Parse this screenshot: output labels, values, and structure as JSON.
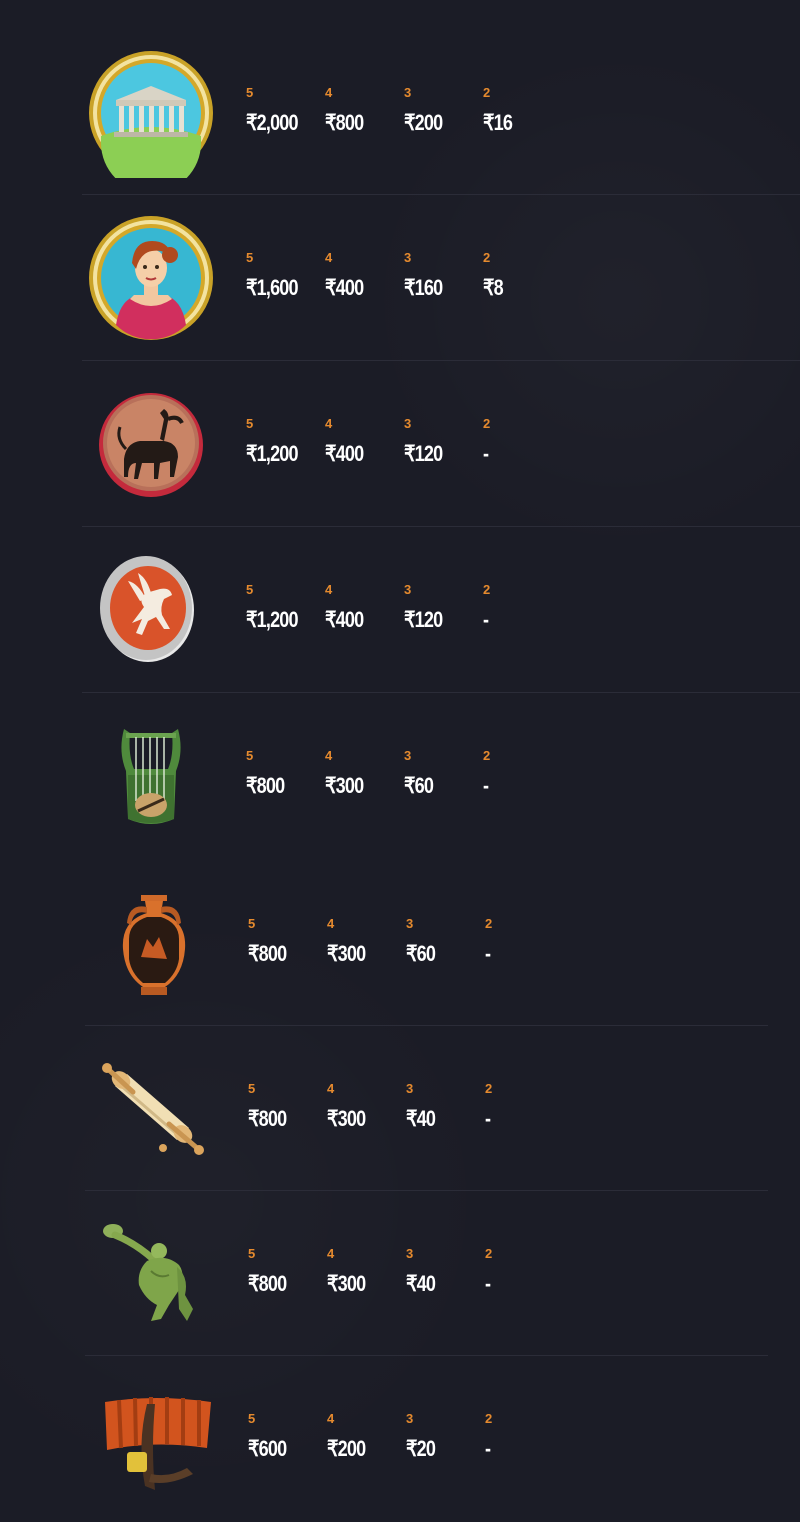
{
  "paytable": {
    "rows": [
      {
        "symbol_icon": "temple-icon",
        "pays": [
          {
            "count": "5",
            "amount": "₹2,000"
          },
          {
            "count": "4",
            "amount": "₹800"
          },
          {
            "count": "3",
            "amount": "₹200"
          },
          {
            "count": "2",
            "amount": "₹16"
          }
        ]
      },
      {
        "symbol_icon": "woman-portrait-icon",
        "pays": [
          {
            "count": "5",
            "amount": "₹1,600"
          },
          {
            "count": "4",
            "amount": "₹400"
          },
          {
            "count": "3",
            "amount": "₹160"
          },
          {
            "count": "2",
            "amount": "₹8"
          }
        ]
      },
      {
        "symbol_icon": "centaur-plate-icon",
        "pays": [
          {
            "count": "5",
            "amount": "₹1,200"
          },
          {
            "count": "4",
            "amount": "₹400"
          },
          {
            "count": "3",
            "amount": "₹120"
          },
          {
            "count": "2",
            "amount": "-"
          }
        ]
      },
      {
        "symbol_icon": "pegasus-shield-icon",
        "pays": [
          {
            "count": "5",
            "amount": "₹1,200"
          },
          {
            "count": "4",
            "amount": "₹400"
          },
          {
            "count": "3",
            "amount": "₹120"
          },
          {
            "count": "2",
            "amount": "-"
          }
        ]
      },
      {
        "symbol_icon": "lyre-icon",
        "pays": [
          {
            "count": "5",
            "amount": "₹800"
          },
          {
            "count": "4",
            "amount": "₹300"
          },
          {
            "count": "3",
            "amount": "₹60"
          },
          {
            "count": "2",
            "amount": "-"
          }
        ]
      },
      {
        "symbol_icon": "amphora-icon",
        "pays": [
          {
            "count": "5",
            "amount": "₹800"
          },
          {
            "count": "4",
            "amount": "₹300"
          },
          {
            "count": "3",
            "amount": "₹60"
          },
          {
            "count": "2",
            "amount": "-"
          }
        ]
      },
      {
        "symbol_icon": "scroll-icon",
        "pays": [
          {
            "count": "5",
            "amount": "₹800"
          },
          {
            "count": "4",
            "amount": "₹300"
          },
          {
            "count": "3",
            "amount": "₹40"
          },
          {
            "count": "2",
            "amount": "-"
          }
        ]
      },
      {
        "symbol_icon": "discus-thrower-icon",
        "pays": [
          {
            "count": "5",
            "amount": "₹800"
          },
          {
            "count": "4",
            "amount": "₹300"
          },
          {
            "count": "3",
            "amount": "₹40"
          },
          {
            "count": "2",
            "amount": "-"
          }
        ]
      },
      {
        "symbol_icon": "galley-ship-icon",
        "pays": [
          {
            "count": "5",
            "amount": "₹600"
          },
          {
            "count": "4",
            "amount": "₹200"
          },
          {
            "count": "3",
            "amount": "₹20"
          },
          {
            "count": "2",
            "amount": "-"
          }
        ]
      }
    ]
  }
}
